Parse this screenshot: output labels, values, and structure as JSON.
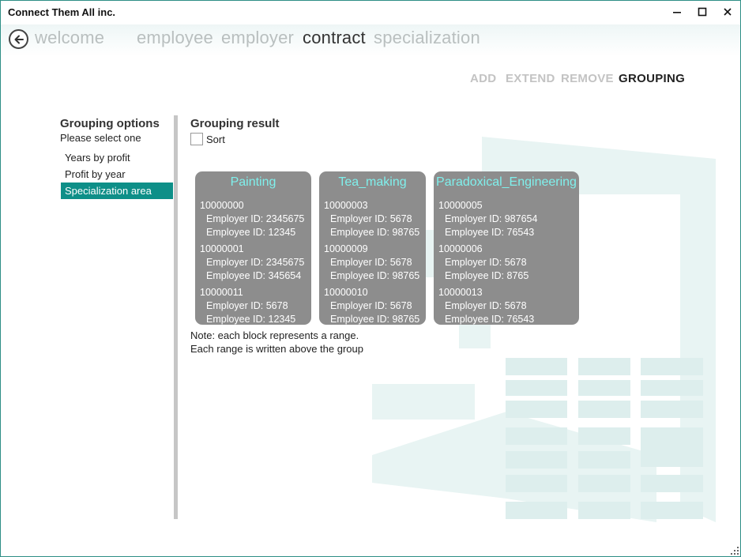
{
  "window": {
    "title": "Connect Them All inc."
  },
  "window_controls": {
    "minimize": "—",
    "maximize": "☐",
    "close": "✕"
  },
  "nav": {
    "back_icon": "arrow-left-circle-icon",
    "items": [
      {
        "label": "welcome",
        "active": false
      },
      {
        "label": "employee",
        "active": false
      },
      {
        "label": "employer",
        "active": false
      },
      {
        "label": "contract",
        "active": true
      },
      {
        "label": "specialization",
        "active": false
      }
    ]
  },
  "actions": {
    "add": "ADD",
    "extend": "EXTEND",
    "remove": "REMOVE",
    "grouping": "GROUPING"
  },
  "options": {
    "title": "Grouping options",
    "subtitle": "Please select one",
    "items": [
      "Years by profit",
      "Profit by year",
      "Specialization area"
    ],
    "selected_index": 2
  },
  "result": {
    "title": "Grouping result",
    "sort_label": "Sort",
    "sort_checked": false,
    "groups": [
      {
        "name": "Painting",
        "entries": [
          {
            "id": "10000000",
            "employer": "Employer ID: 2345675",
            "employee": "Employee ID: 12345"
          },
          {
            "id": "10000001",
            "employer": "Employer ID: 2345675",
            "employee": "Employee ID: 345654"
          },
          {
            "id": "10000011",
            "employer": "Employer ID: 5678",
            "employee": "Employee ID: 12345"
          }
        ]
      },
      {
        "name": "Tea_making",
        "entries": [
          {
            "id": "10000003",
            "employer": "Employer ID: 5678",
            "employee": "Employee ID: 98765"
          },
          {
            "id": "10000009",
            "employer": "Employer ID: 5678",
            "employee": "Employee ID: 98765"
          },
          {
            "id": "10000010",
            "employer": "Employer ID: 5678",
            "employee": "Employee ID: 98765"
          }
        ]
      },
      {
        "name": "Paradoxical_Engineering",
        "entries": [
          {
            "id": "10000005",
            "employer": "Employer ID: 987654",
            "employee": "Employee ID: 76543"
          },
          {
            "id": "10000006",
            "employer": "Employer ID: 5678",
            "employee": "Employee ID: 8765"
          },
          {
            "id": "10000013",
            "employer": "Employer ID: 5678",
            "employee": "Employee ID: 76543"
          }
        ]
      }
    ],
    "note_line1": "Note: each block represents a range.",
    "note_line2": "Each range is written above the group"
  },
  "colors": {
    "accent": "#0e8f88",
    "group_bg": "#8d8d8d",
    "group_title": "#7ff0ec",
    "watermark": "#e6f3f2"
  }
}
